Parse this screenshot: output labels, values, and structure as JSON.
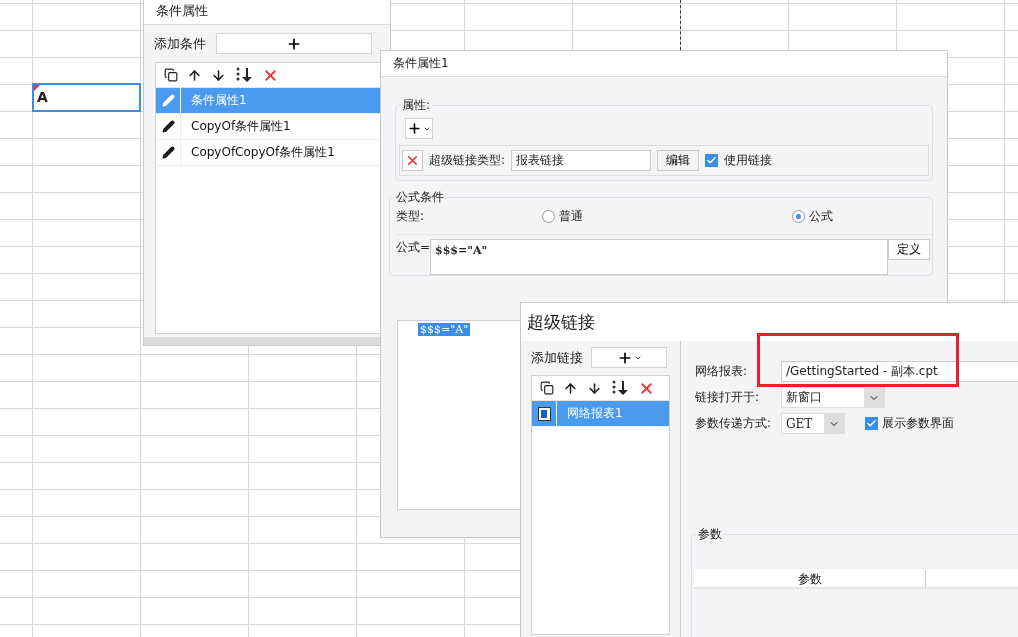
{
  "sheet": {
    "cell_text": "A"
  },
  "condition_panel": {
    "title": "条件属性",
    "add_label": "添加条件",
    "items": [
      {
        "label": "条件属性1",
        "selected": true
      },
      {
        "label": "CopyOf条件属性1",
        "selected": false
      },
      {
        "label": "CopyOfCopyOf条件属性1",
        "selected": false
      }
    ]
  },
  "properties_dialog": {
    "title": "条件属性1",
    "attributes_legend": "属性:",
    "hyperlink_type_label": "超级链接类型:",
    "hyperlink_type_value": "报表链接",
    "edit_button": "编辑",
    "use_link": {
      "label": "使用链接",
      "checked": true
    },
    "formula_legend": "公式条件",
    "type_label": "类型:",
    "types": [
      {
        "label": "普通",
        "selected": false
      },
      {
        "label": "公式",
        "selected": true
      }
    ],
    "formula_label": "公式=",
    "formula_value": "$$$=\"A\"",
    "define_button": "定义",
    "tree_item": "$$$=\"A\""
  },
  "hyperlink_dialog": {
    "title": "超级链接",
    "add_label": "添加链接",
    "links": [
      {
        "label": "网络报表1",
        "selected": true
      }
    ],
    "report_label": "网络报表:",
    "report_value": "/GettingStarted - 副本.cpt",
    "open_in_label": "链接打开于:",
    "open_in_value": "新窗口",
    "param_method_label": "参数传递方式:",
    "param_method_value": "GET",
    "show_params": {
      "label": "展示参数界面",
      "checked": true
    },
    "params_legend": "参数",
    "params_columns": [
      "参数"
    ]
  }
}
